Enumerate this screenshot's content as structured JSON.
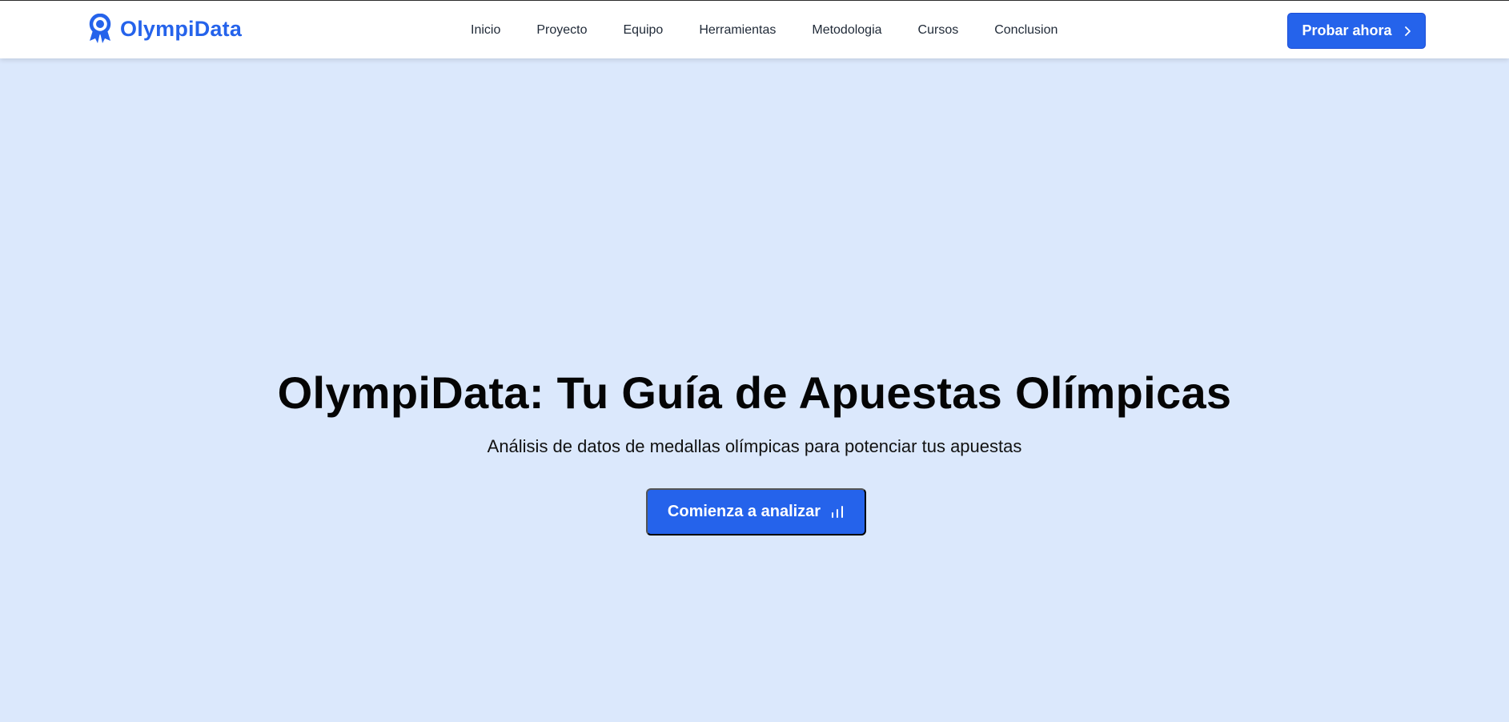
{
  "brand": {
    "name": "OlympiData",
    "icon": "award-icon",
    "color": "#2563eb"
  },
  "nav": {
    "links": [
      {
        "label": "Inicio"
      },
      {
        "label": "Proyecto"
      },
      {
        "label": "Equipo"
      },
      {
        "label": "Herramientas"
      },
      {
        "label": "Metodologia"
      },
      {
        "label": "Cursos"
      },
      {
        "label": "Conclusion"
      }
    ],
    "cta_label": "Probar ahora",
    "cta_icon": "chevron-right-icon"
  },
  "hero": {
    "title": "OlympiData: Tu Guía de Apuestas Olímpicas",
    "subtitle": "Análisis de datos de medallas olímpicas para potenciar tus apuestas",
    "button_label": "Comienza a analizar",
    "button_icon": "bar-chart-icon",
    "background": "#dbe8fc"
  }
}
